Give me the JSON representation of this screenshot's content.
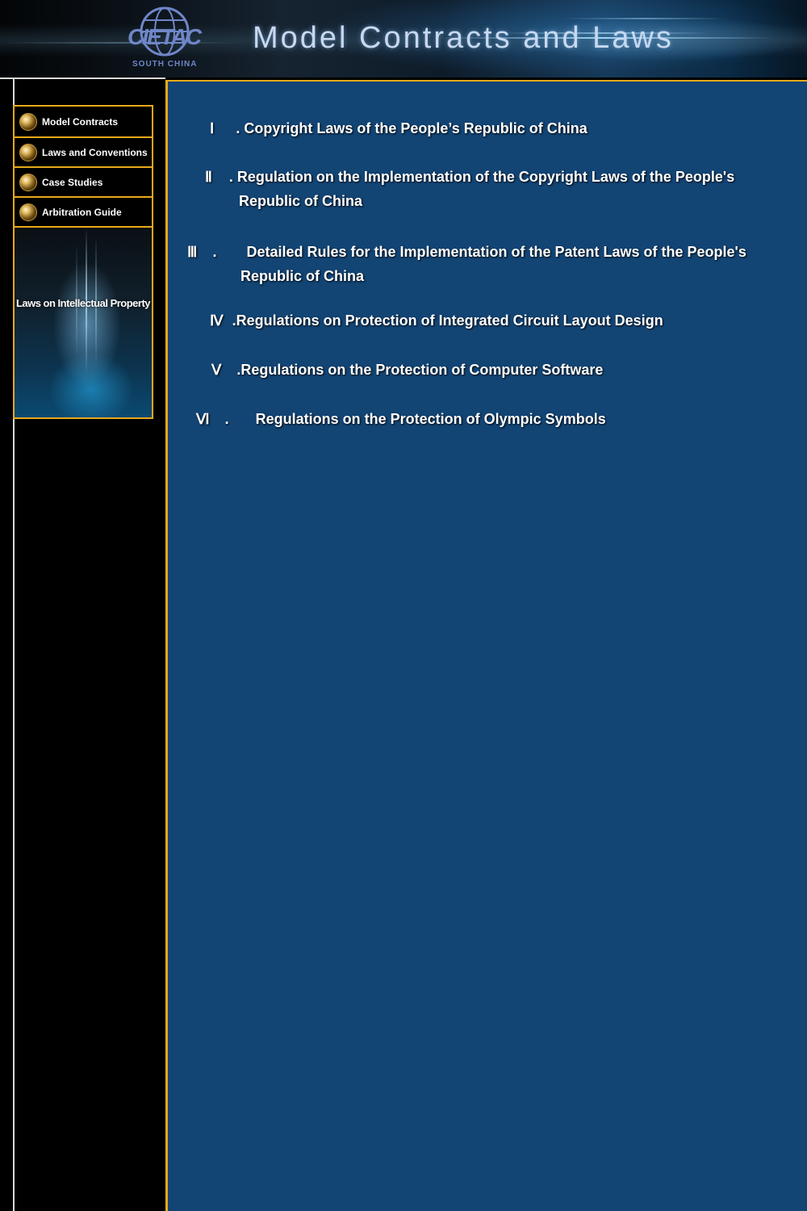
{
  "header": {
    "logo_text": "CIETAC",
    "logo_sub": "SOUTH CHINA",
    "title": "Model Contracts and Laws"
  },
  "sidebar": {
    "items": [
      {
        "label": "Model Contracts"
      },
      {
        "label": "Laws and Conventions"
      },
      {
        "label": "Case Studies"
      },
      {
        "label": "Arbitration Guide"
      }
    ],
    "promo_text": "Laws on Intellectual Property"
  },
  "laws": [
    {
      "num": "Ⅰ",
      "sep": ".",
      "title": "Copyright Laws of the People’s Republic of China"
    },
    {
      "num": "Ⅱ",
      "sep": ".",
      "title": "Regulation on the Implementation of the Copyright Laws of the People's",
      "title2": "Republic of China"
    },
    {
      "num": "Ⅲ",
      "sep": ".",
      "title": "Detailed Rules for the Implementation of the Patent Laws of the People's",
      "title2": "Republic of China"
    },
    {
      "num": "Ⅳ",
      "sep": ".",
      "title": "Regulations on Protection of Integrated Circuit Layout Design"
    },
    {
      "num": "Ⅴ",
      "sep": ".",
      "title": "Regulations on the Protection of Computer Software"
    },
    {
      "num": "Ⅵ",
      "sep": ".",
      "title": "Regulations on the Protection of Olympic Symbols"
    }
  ]
}
